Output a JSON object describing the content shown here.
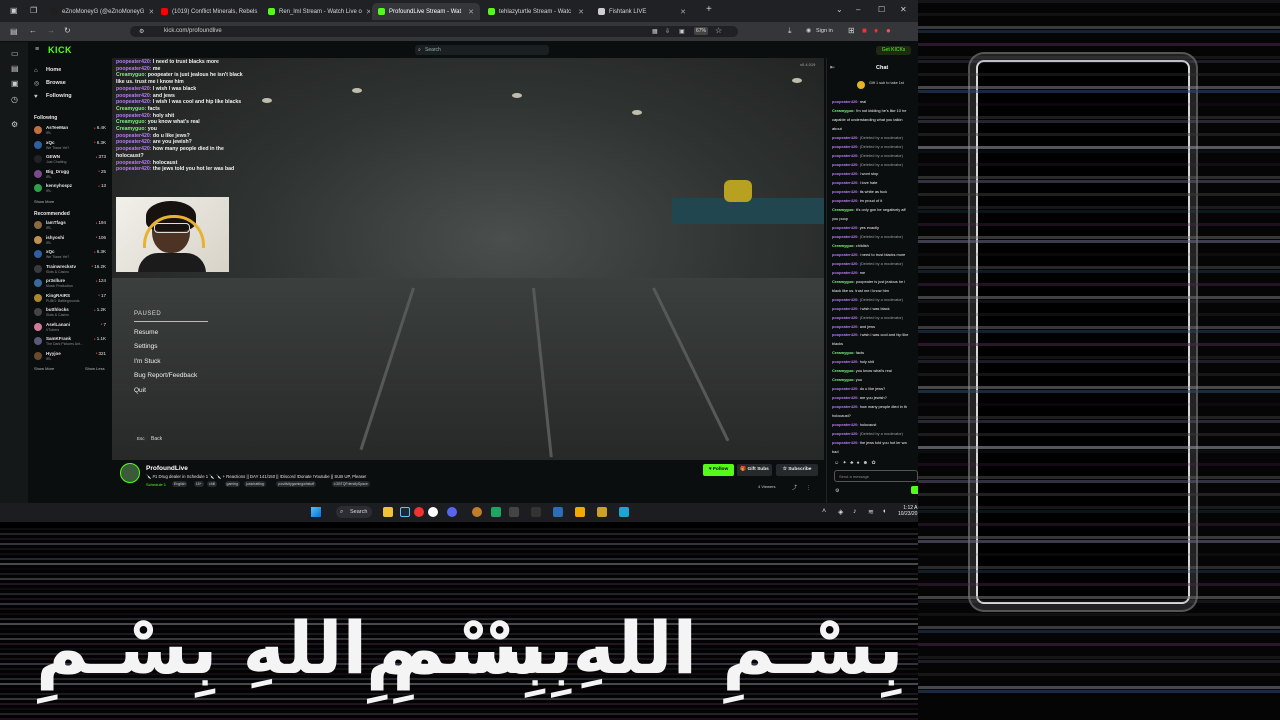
{
  "browser": {
    "tabs": [
      {
        "label": "eZnoMoneyG (@eZnoMoneyG",
        "fav": "#1f1f1f",
        "active": false
      },
      {
        "label": "(1019) Conflict Minerals, Rebels",
        "fav": "#ff0000",
        "active": false
      },
      {
        "label": "Ren_lml Stream - Watch Live o",
        "fav": "#53fc18",
        "active": false
      },
      {
        "label": "ProfoundLive Stream - Wat",
        "fav": "#53fc18",
        "active": true
      },
      {
        "label": "tehlazyturtle Stream - Watc",
        "fav": "#53fc18",
        "active": false
      },
      {
        "label": "Fishtank LIVE",
        "fav": "#cfcfcf",
        "active": false
      }
    ],
    "url": "kick.com/profoundlive",
    "zoom": "67%",
    "sign_in": "Sign in"
  },
  "kick": {
    "logo": "KICK",
    "search_placeholder": "Search",
    "get_kicks": "Get KICKs",
    "nav": {
      "home": "Home",
      "browse": "Browse",
      "following": "Following"
    },
    "following_title": "Following",
    "following": [
      {
        "name": "AsTeeMan",
        "category": "IRL",
        "viewers": "6.4K",
        "color": "#c07040"
      },
      {
        "name": "xQc",
        "category": "We Tfaws Yet?",
        "viewers": "6.3K",
        "color": "#2f5fa0"
      },
      {
        "name": "GEWN",
        "category": "Just Chatting",
        "viewers": "373",
        "color": "#222222"
      },
      {
        "name": "Big_Drugg",
        "category": "IRL",
        "viewers": "25",
        "color": "#7a4a8a"
      },
      {
        "name": "kennyhospz",
        "category": "IRL",
        "viewers": "13",
        "color": "#2fa04a"
      }
    ],
    "show_more": "Show More",
    "recommended_title": "Recommended",
    "recommended": [
      {
        "name": "lamTfags",
        "category": "IRL",
        "viewers": "194",
        "color": "#8a6a40"
      },
      {
        "name": "ishyoshi",
        "category": "IRL",
        "viewers": "106",
        "color": "#c09050"
      },
      {
        "name": "xQc",
        "category": "We Tfaws Yet?",
        "viewers": "6.3K",
        "color": "#2f5fa0"
      },
      {
        "name": "Trainwreckstv",
        "category": "Slots & Casino",
        "viewers": "16.2K",
        "color": "#3a3a3a"
      },
      {
        "name": "pr3sllure",
        "category": "Music Production",
        "viewers": "124",
        "color": "#3a6a9a"
      },
      {
        "name": "KingRAIRS",
        "category": "PUBG: Battlegrounds",
        "viewers": "17",
        "color": "#aa8830"
      },
      {
        "name": "butthlocks",
        "category": "Slots & Casino",
        "viewers": "1.2K",
        "color": "#444444"
      },
      {
        "name": "AselLanani",
        "category": "VTubers",
        "viewers": "7",
        "color": "#d07a9a"
      },
      {
        "name": "SamKFrank",
        "category": "The Dark Pictures Ant...",
        "viewers": "1.1K",
        "color": "#5a5a7a"
      },
      {
        "name": "Hyyjoe",
        "category": "IRL",
        "viewers": "321",
        "color": "#6a4a2a"
      }
    ],
    "show_more_2": "Show More",
    "show_less": "Show Less",
    "version": "v0.4.019"
  },
  "overlay_chat": [
    {
      "user": "poopeater420:",
      "color": "u1",
      "msg": "I need to trust blacks more"
    },
    {
      "user": "poopeater420:",
      "color": "u1",
      "msg": "me"
    },
    {
      "user": "Creamyguo:",
      "color": "u2",
      "msg": "poopeater is just jealous he isn't black"
    },
    {
      "user": "",
      "color": "u2",
      "msg": "like us. trust me i know him"
    },
    {
      "user": "poopeater420:",
      "color": "u1",
      "msg": "I wish I was black"
    },
    {
      "user": "poopeater420:",
      "color": "u1",
      "msg": "and jews"
    },
    {
      "user": "poopeater420:",
      "color": "u1",
      "msg": "I wish I was cool and hip like blacks"
    },
    {
      "user": "Creamyguo:",
      "color": "u2",
      "msg": "facts"
    },
    {
      "user": "poopeater420:",
      "color": "u1",
      "msg": "holy shit"
    },
    {
      "user": "Creamyguo:",
      "color": "u2",
      "msg": "you know what's real"
    },
    {
      "user": "Creamyguo:",
      "color": "u2",
      "msg": "you"
    },
    {
      "user": "poopeater420:",
      "color": "u1",
      "msg": "do u like jews?"
    },
    {
      "user": "poopeater420:",
      "color": "u1",
      "msg": "are you jewish?"
    },
    {
      "user": "poopeater420:",
      "color": "u1",
      "msg": "how many people died in the"
    },
    {
      "user": "",
      "color": "u1",
      "msg": "holocaust?"
    },
    {
      "user": "poopeater420:",
      "color": "u1",
      "msg": "holocaust"
    },
    {
      "user": "poopeater420:",
      "color": "u1",
      "msg": "the jews told you hot ler was bad"
    }
  ],
  "pause_menu": {
    "title": "PAUSED",
    "items": [
      "Resume",
      "Settings",
      "I'm Stuck",
      "Bug Report/Feedback",
      "Quit"
    ],
    "esc_key": "Esc",
    "esc_label": "Back"
  },
  "stream": {
    "streamer": "ProfoundLive",
    "title": "🔪 #1 Drug dealer in Schedule 1 🔪 🔪 + Reactions || DAY 141/150 || !Discord !Donate !Youtube || SUB UP, Please!",
    "category": "Schedule 1",
    "tags": [
      "English",
      "18+",
      "chill",
      "gaming",
      "justchatting",
      "positivitygamingwhstuff",
      "LGBTQFriendlySpace"
    ],
    "follow": "Follow",
    "gift_subs": "Gift Subs",
    "subscribe": "Subscribe",
    "viewers": "4 Viewers"
  },
  "chat": {
    "title": "Chat",
    "pinned": "Gift 1 sub to take 1st",
    "input_placeholder": "Send a message",
    "lines": [
      {
        "user": "poopeater420:",
        "c": "a",
        "msg": "real",
        "deleted": false
      },
      {
        "user": "Creamyguo:",
        "c": "b",
        "msg": "i'm not kidding he's like 10 he",
        "deleted": false
      },
      {
        "user": "",
        "c": "b",
        "msg": "capable of understanding what you talkin",
        "deleted": false
      },
      {
        "user": "",
        "c": "b",
        "msg": "about",
        "deleted": false
      },
      {
        "user": "poopeater420:",
        "c": "a",
        "msg": "(Deleted by a moderator)",
        "deleted": true
      },
      {
        "user": "poopeater420:",
        "c": "a",
        "msg": "(Deleted by a moderator)",
        "deleted": true
      },
      {
        "user": "poopeater420:",
        "c": "a",
        "msg": "(Deleted by a moderator)",
        "deleted": true
      },
      {
        "user": "poopeater420:",
        "c": "a",
        "msg": "(Deleted by a moderator)",
        "deleted": true
      },
      {
        "user": "poopeater420:",
        "c": "a",
        "msg": "i wont stop",
        "deleted": false
      },
      {
        "user": "poopeater420:",
        "c": "a",
        "msg": "i love hate",
        "deleted": false
      },
      {
        "user": "poopeater420:",
        "c": "a",
        "msg": "its white as fuck",
        "deleted": false
      },
      {
        "user": "poopeater420:",
        "c": "a",
        "msg": "im proud of it",
        "deleted": false
      },
      {
        "user": "Creamyguo:",
        "c": "b",
        "msg": "it's only gon be negatively aff",
        "deleted": false
      },
      {
        "user": "",
        "c": "b",
        "msg": "you poop",
        "deleted": false
      },
      {
        "user": "poopeater420:",
        "c": "a",
        "msg": "yes exactly",
        "deleted": false
      },
      {
        "user": "poopeater420:",
        "c": "a",
        "msg": "(Deleted by a moderator)",
        "deleted": true
      },
      {
        "user": "Creamyguo:",
        "c": "b",
        "msg": "childish",
        "deleted": false
      },
      {
        "user": "poopeater420:",
        "c": "a",
        "msg": "i need to trust blacks more",
        "deleted": false
      },
      {
        "user": "poopeater420:",
        "c": "a",
        "msg": "(Deleted by a moderator)",
        "deleted": true
      },
      {
        "user": "poopeater420:",
        "c": "a",
        "msg": "me",
        "deleted": false
      },
      {
        "user": "Creamyguo:",
        "c": "b",
        "msg": "poopeater is just jealous he i",
        "deleted": false
      },
      {
        "user": "",
        "c": "b",
        "msg": "black like us. trust me i know him",
        "deleted": false
      },
      {
        "user": "poopeater420:",
        "c": "a",
        "msg": "(Deleted by a moderator)",
        "deleted": true
      },
      {
        "user": "poopeater420:",
        "c": "a",
        "msg": "i wish i was black",
        "deleted": false
      },
      {
        "user": "poopeater420:",
        "c": "a",
        "msg": "(Deleted by a moderator)",
        "deleted": true
      },
      {
        "user": "poopeater420:",
        "c": "a",
        "msg": "and jews",
        "deleted": false
      },
      {
        "user": "poopeater420:",
        "c": "a",
        "msg": "i wish i was cool and hip like",
        "deleted": false
      },
      {
        "user": "",
        "c": "a",
        "msg": "blacks",
        "deleted": false
      },
      {
        "user": "Creamyguo:",
        "c": "b",
        "msg": "facts",
        "deleted": false
      },
      {
        "user": "poopeater420:",
        "c": "a",
        "msg": "holy shit",
        "deleted": false
      },
      {
        "user": "Creamyguo:",
        "c": "b",
        "msg": "you know what's real",
        "deleted": false
      },
      {
        "user": "Creamyguo:",
        "c": "b",
        "msg": "you",
        "deleted": false
      },
      {
        "user": "poopeater420:",
        "c": "a",
        "msg": "do u like jews?",
        "deleted": false
      },
      {
        "user": "poopeater420:",
        "c": "a",
        "msg": "are you jewish?",
        "deleted": false
      },
      {
        "user": "poopeater420:",
        "c": "a",
        "msg": "how many people died in th",
        "deleted": false
      },
      {
        "user": "",
        "c": "a",
        "msg": "holocaust?",
        "deleted": false
      },
      {
        "user": "poopeater420:",
        "c": "a",
        "msg": "holocaust",
        "deleted": false
      },
      {
        "user": "poopeater420:",
        "c": "a",
        "msg": "(Deleted by a moderator)",
        "deleted": true
      },
      {
        "user": "poopeater420:",
        "c": "a",
        "msg": "the jews told you hot ler wa",
        "deleted": false
      },
      {
        "user": "",
        "c": "a",
        "msg": "bad",
        "deleted": false
      }
    ]
  },
  "taskbar": {
    "search": "Search",
    "time": "1:12 A",
    "date": "10/23/20"
  },
  "overlay_text": {
    "left": "بِسْـمِ اللهِ بِسْـمِ",
    "right": "بِسْـمِ اللهِ بِسْـمِ"
  },
  "colors": {
    "kick_green": "#53fc18",
    "chat_purple": "#b77cf3",
    "chat_green": "#7df17f"
  }
}
